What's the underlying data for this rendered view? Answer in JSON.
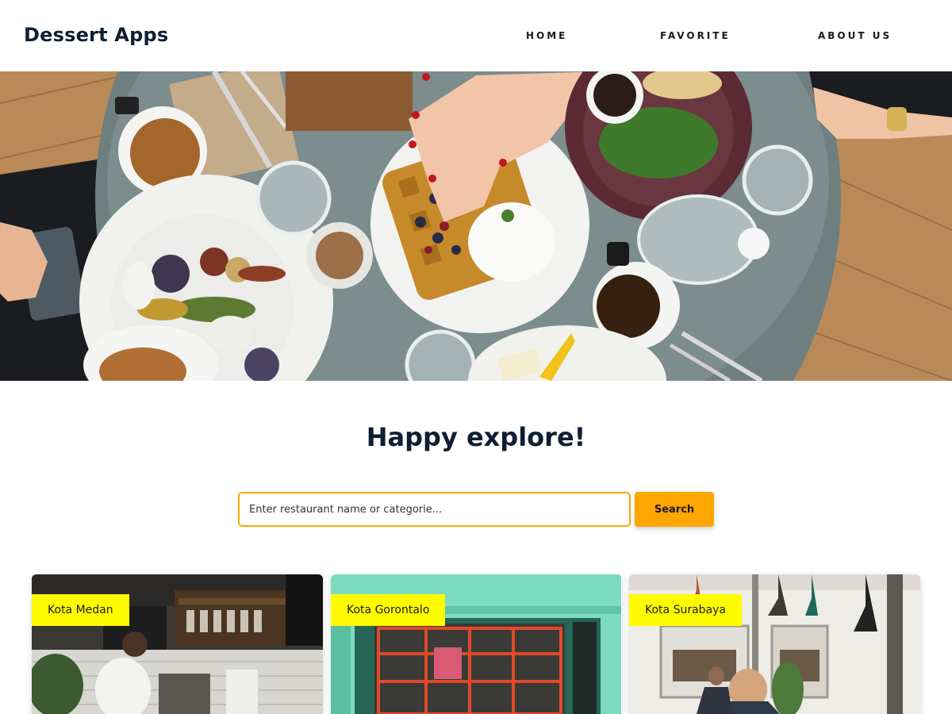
{
  "header": {
    "brand": "Dessert Apps",
    "nav": [
      {
        "label": "HOME"
      },
      {
        "label": "FAVORITE"
      },
      {
        "label": "ABOUT US"
      }
    ]
  },
  "hero": {
    "alt": "Top-down view of a breakfast table with waffles, coffee and salad"
  },
  "main": {
    "title": "Happy explore!",
    "search": {
      "placeholder": "Enter restaurant name or categorie...",
      "value": "",
      "button_label": "Search"
    },
    "restaurants": [
      {
        "city": "Kota Medan"
      },
      {
        "city": "Kota Gorontalo"
      },
      {
        "city": "Kota Surabaya"
      }
    ]
  },
  "colors": {
    "accent": "#ffa600",
    "input_border": "#f7a800",
    "badge": "#fffb00",
    "text_dark": "#0f1f33"
  }
}
